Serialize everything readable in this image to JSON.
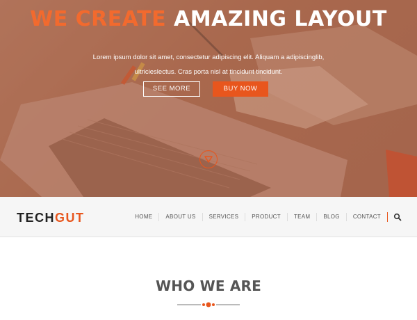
{
  "hero": {
    "title_accent": "WE CREATE",
    "title_rest": "AMAZING LAYOUT",
    "text": "Lorem ipsum dolor sit amet, consectetur adipiscing elit. Aliquam a adipiscinglib, ultricieslectus. Cras porta nisl at tincidunt tincidunt.",
    "see_more_label": "SEE MORE",
    "buy_now_label": "BUY NOW",
    "scroll_icon": "chevron-down-circle-icon"
  },
  "navbar": {
    "logo_part1": "TECH",
    "logo_part2": "GUT",
    "items": [
      {
        "label": "HOME"
      },
      {
        "label": "ABOUT US"
      },
      {
        "label": "SERVICES"
      },
      {
        "label": "PRODUCT"
      },
      {
        "label": "TEAM"
      },
      {
        "label": "BLOG"
      },
      {
        "label": "CONTACT"
      }
    ],
    "search_icon": "search-icon"
  },
  "section": {
    "title": "WHO WE ARE"
  },
  "colors": {
    "accent": "#e8561d",
    "hero_overlay": "#a96f57",
    "nav_bg": "#f6f6f6",
    "heading": "#555555"
  }
}
